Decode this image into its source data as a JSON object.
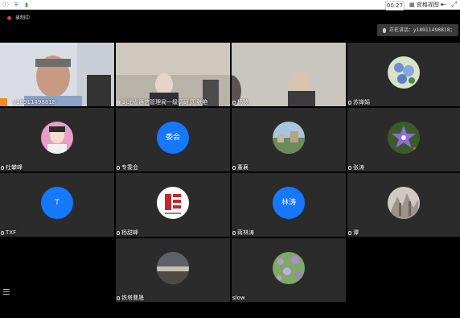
{
  "toolbar": {
    "duration": "00:27",
    "view_label": "宫格视图"
  },
  "recording": {
    "label": "录制中"
  },
  "speaking": {
    "label": "正在讲话：y18911498818；"
  },
  "participants": [
    {
      "name": "y18911498818",
      "avatar_text": ""
    },
    {
      "name": "湖北省通信管理局一级调研员 张艳",
      "avatar_text": ""
    },
    {
      "name": "杨波",
      "avatar_text": ""
    },
    {
      "name": "苏婵娟",
      "avatar_text": ""
    },
    {
      "name": "杜攀峰",
      "avatar_text": ""
    },
    {
      "name": "专委会",
      "avatar_text": "委会"
    },
    {
      "name": "董襄",
      "avatar_text": ""
    },
    {
      "name": "张涛",
      "avatar_text": ""
    },
    {
      "name": "TXF",
      "avatar_text": "T"
    },
    {
      "name": "杨甜峰",
      "avatar_text": ""
    },
    {
      "name": "蒋林涛",
      "avatar_text": "林涛"
    },
    {
      "name": "谭",
      "avatar_text": ""
    },
    {
      "name": "铁塔曹晟",
      "avatar_text": ""
    },
    {
      "name": "slow",
      "avatar_text": ""
    }
  ],
  "colors": {
    "active_speaker_border": "#2fbf4a",
    "avatar_blue": "#1677ff",
    "tile_bg": "#2b2b2b"
  }
}
